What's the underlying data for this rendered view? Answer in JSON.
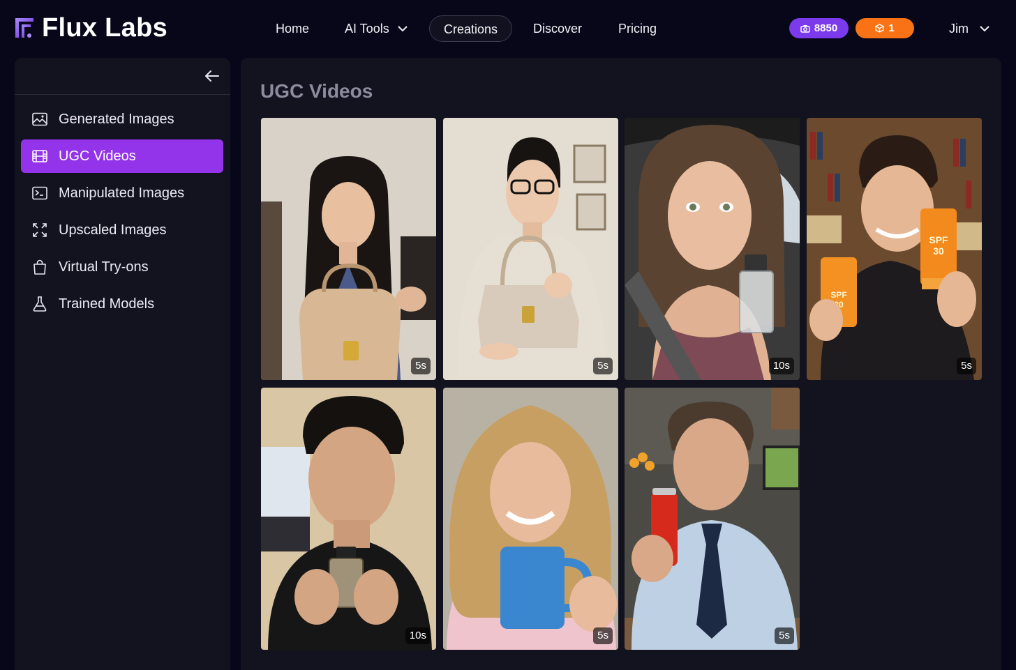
{
  "app": {
    "name": "Flux Labs",
    "logo_icon": "flux-logo-icon"
  },
  "nav": {
    "home": "Home",
    "ai_tools": "AI Tools",
    "creations": "Creations",
    "discover": "Discover",
    "pricing": "Pricing"
  },
  "header": {
    "credits": "8850",
    "gems": "1",
    "user_name": "Jim",
    "colors": {
      "credits_bg": "#7c3aed",
      "gems_bg": "#f97316"
    }
  },
  "sidebar": {
    "items": [
      {
        "label": "Generated Images",
        "icon": "image-icon"
      },
      {
        "label": "UGC Videos",
        "icon": "film-icon",
        "active": true
      },
      {
        "label": "Manipulated Images",
        "icon": "terminal-icon"
      },
      {
        "label": "Upscaled Images",
        "icon": "expand-icon"
      },
      {
        "label": "Virtual Try-ons",
        "icon": "shopping-bag-icon"
      },
      {
        "label": "Trained Models",
        "icon": "flask-icon"
      }
    ],
    "active_color": "#9333ea"
  },
  "main": {
    "title": "UGC Videos",
    "videos": [
      {
        "duration": "5s"
      },
      {
        "duration": "5s"
      },
      {
        "duration": "10s"
      },
      {
        "duration": "5s"
      },
      {
        "duration": "10s"
      },
      {
        "duration": "5s"
      },
      {
        "duration": "5s"
      }
    ]
  }
}
